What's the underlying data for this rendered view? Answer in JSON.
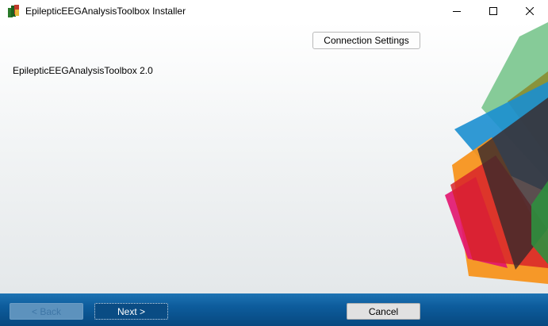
{
  "window": {
    "title": "EpilepticEEGAnalysisToolbox Installer",
    "icon": "installer-app-icon",
    "controls": [
      "minimize-icon",
      "maximize-icon",
      "close-icon"
    ]
  },
  "header": {
    "connection_settings_label": "Connection Settings"
  },
  "main": {
    "product_label": "EpilepticEEGAnalysisToolbox 2.0"
  },
  "footer": {
    "back_label": "< Back",
    "next_label": "Next >",
    "cancel_label": "Cancel"
  },
  "colors": {
    "footer_blue": "#0d5c9c",
    "art_green": "#7cc78f",
    "art_orange": "#f7941d",
    "art_blue": "#1b8fd0",
    "art_magenta": "#e2136e",
    "art_red": "#d8232a",
    "art_dark": "#3b2a2b"
  }
}
